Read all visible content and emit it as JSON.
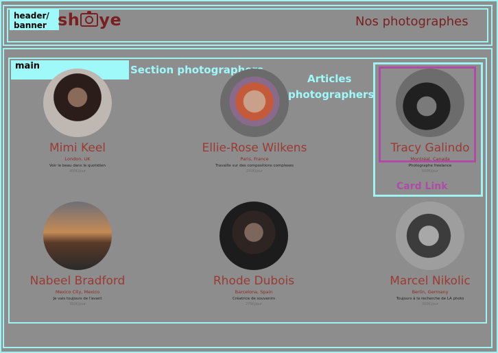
{
  "header": {
    "tag": "header/\nbanner",
    "logo_left": "sh",
    "logo_right": "ye",
    "title": "Nos photographes"
  },
  "main": {
    "tag": "main",
    "section_label": "Section photographers",
    "articles_label_1": "Articles",
    "articles_label_2": "photographers",
    "card_link_label": "Card Link"
  },
  "photographers": [
    {
      "name": "Mimi Keel",
      "location": "London, UK",
      "tagline": "Voir le beau dans le quotidien",
      "price": "400€/jour"
    },
    {
      "name": "Ellie-Rose Wilkens",
      "location": "Paris, France",
      "tagline": "Travaille sur des compositions complexes",
      "price": "250€/jour"
    },
    {
      "name": "Tracy Galindo",
      "location": "Montréal, Canada",
      "tagline": "Photographe freelance",
      "price": "500€/jour"
    },
    {
      "name": "Nabeel Bradford",
      "location": "Mexico City, Mexico",
      "tagline": "Je vais toujours de l'avant",
      "price": "350€/jour"
    },
    {
      "name": "Rhode Dubois",
      "location": "Barcelona, Spain",
      "tagline": "Créatrice de souvenirs",
      "price": "275€/jour"
    },
    {
      "name": "Marcel Nikolic",
      "location": "Berlin, Germany",
      "tagline": "Toujours à la recherche de LA photo",
      "price": "300€/jour"
    }
  ],
  "colors": {
    "overlay_cyan": "#9ff3f3",
    "card_link_purple": "#b04aa8",
    "brand_red": "#7a1f1f"
  }
}
